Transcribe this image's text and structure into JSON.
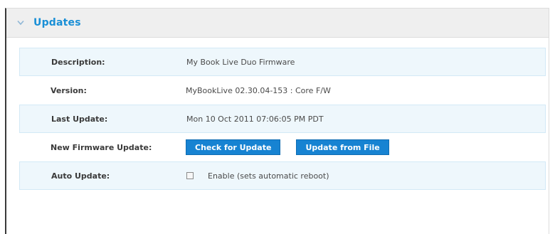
{
  "section": {
    "title": "Updates"
  },
  "rows": {
    "description": {
      "label": "Description:",
      "value": "My Book Live Duo Firmware"
    },
    "version": {
      "label": "Version:",
      "value": "MyBookLive 02.30.04-153 : Core F/W"
    },
    "last_update": {
      "label": "Last Update:",
      "value": "Mon 10 Oct 2011 07:06:05 PM PDT"
    },
    "new_firmware": {
      "label": "New Firmware Update:",
      "check_button": "Check for Update",
      "file_button": "Update from File"
    },
    "auto_update": {
      "label": "Auto Update:",
      "checkbox_label": "Enable (sets automatic reboot)",
      "checked": false
    }
  },
  "colors": {
    "accent": "#1a8fd6",
    "button": "#1783d2",
    "row_alt": "#eef7fc",
    "header_bg": "#efefef"
  },
  "icons": {
    "collapse": "chevron-down-icon"
  }
}
